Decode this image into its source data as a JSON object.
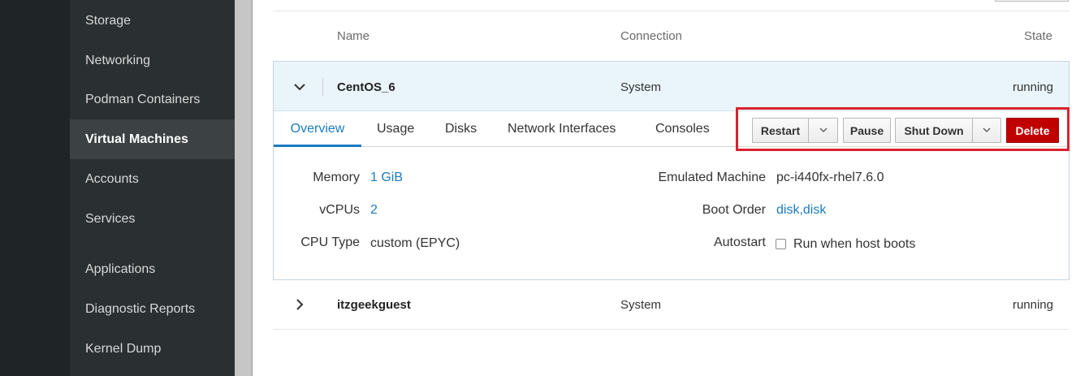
{
  "sidebar": {
    "items": [
      {
        "label": "Storage"
      },
      {
        "label": "Networking"
      },
      {
        "label": "Podman Containers"
      },
      {
        "label": "Virtual Machines"
      },
      {
        "label": "Accounts"
      },
      {
        "label": "Services"
      },
      {
        "label": "Applications"
      },
      {
        "label": "Diagnostic Reports"
      },
      {
        "label": "Kernel Dump"
      }
    ],
    "active": "Virtual Machines"
  },
  "table": {
    "headers": {
      "name": "Name",
      "connection": "Connection",
      "state": "State"
    }
  },
  "vms": [
    {
      "name": "CentOS_6",
      "connection": "System",
      "state": "running",
      "expanded": true
    },
    {
      "name": "itzgeekguest",
      "connection": "System",
      "state": "running",
      "expanded": false
    }
  ],
  "tabs": {
    "items": [
      "Overview",
      "Usage",
      "Disks",
      "Network Interfaces",
      "Consoles"
    ],
    "active": "Overview"
  },
  "actions": {
    "restart": "Restart",
    "pause": "Pause",
    "shutdown": "Shut Down",
    "delete": "Delete"
  },
  "overview": {
    "memory_label": "Memory",
    "memory_value": "1 GiB",
    "vcpus_label": "vCPUs",
    "vcpus_value": "2",
    "cpu_type_label": "CPU Type",
    "cpu_type_value": "custom (EPYC)",
    "emulated_machine_label": "Emulated Machine",
    "emulated_machine_value": "pc-i440fx-rhel7.6.0",
    "boot_order_label": "Boot Order",
    "boot_order_value": "disk,disk",
    "autostart_label": "Autostart",
    "autostart_checkbox_label": "Run when host boots",
    "autostart_checked": false
  },
  "colors": {
    "accent": "#1a7bbf",
    "danger": "#c00000",
    "highlight": "#d9232e",
    "sidebar_bg": "#2a2f32"
  }
}
